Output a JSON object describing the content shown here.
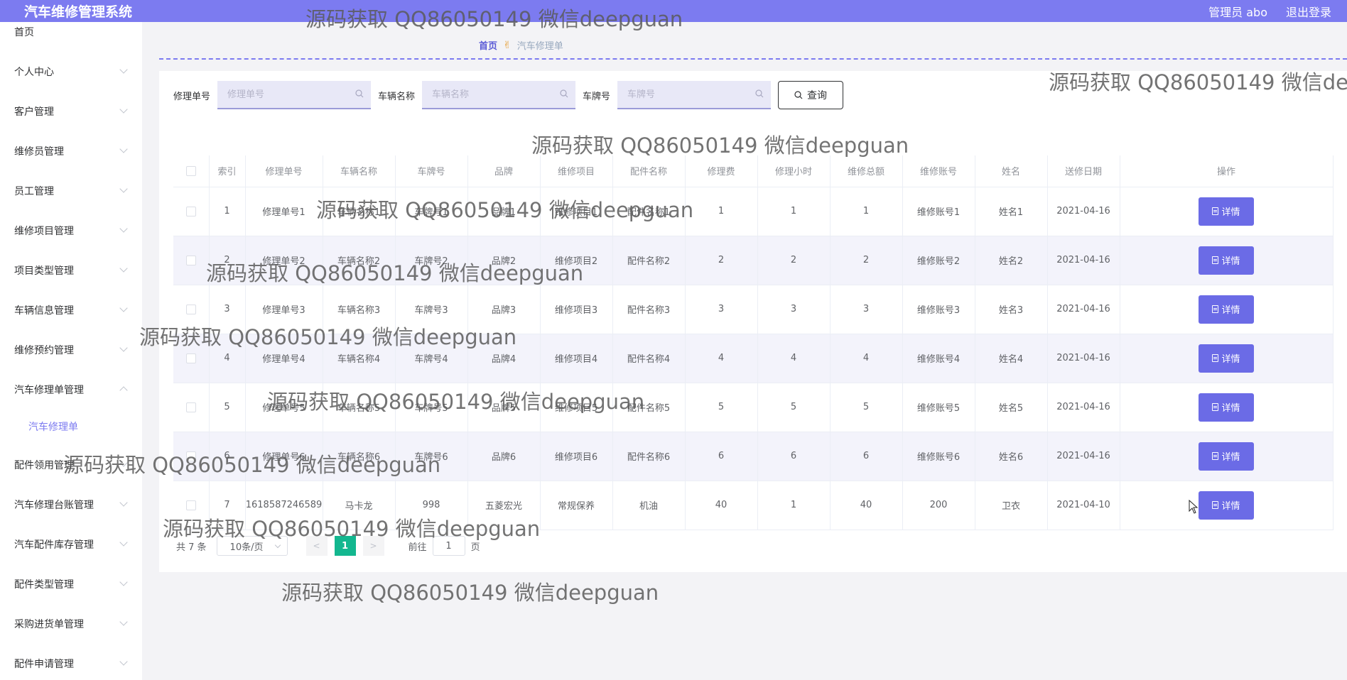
{
  "app": {
    "title": "汽车维修管理系统"
  },
  "user": {
    "greeting": "管理员 abo",
    "logout": "退出登录"
  },
  "sidebar": {
    "items": [
      {
        "label": "首页",
        "expandable": false
      },
      {
        "label": "个人中心",
        "expandable": true
      },
      {
        "label": "客户管理",
        "expandable": true
      },
      {
        "label": "维修员管理",
        "expandable": true
      },
      {
        "label": "员工管理",
        "expandable": true
      },
      {
        "label": "维修项目管理",
        "expandable": true
      },
      {
        "label": "项目类型管理",
        "expandable": true
      },
      {
        "label": "车辆信息管理",
        "expandable": true
      },
      {
        "label": "维修预约管理",
        "expandable": true
      },
      {
        "label": "汽车修理单管理",
        "expandable": true,
        "open": true
      },
      {
        "label": "汽车修理单",
        "sub": true
      },
      {
        "label": "配件领用管理",
        "expandable": true
      },
      {
        "label": "汽车修理台账管理",
        "expandable": true
      },
      {
        "label": "汽车配件库存管理",
        "expandable": true
      },
      {
        "label": "配件类型管理",
        "expandable": true
      },
      {
        "label": "采购进货单管理",
        "expandable": true
      },
      {
        "label": "配件申请管理",
        "expandable": true
      }
    ]
  },
  "breadcrumb": {
    "home": "首页",
    "current": "汽车修理单"
  },
  "search": {
    "fields": [
      {
        "label": "修理单号",
        "placeholder": "修理单号"
      },
      {
        "label": "车辆名称",
        "placeholder": "车辆名称"
      },
      {
        "label": "车牌号",
        "placeholder": "车牌号"
      }
    ],
    "query_label": "查询"
  },
  "table": {
    "columns": [
      "索引",
      "修理单号",
      "车辆名称",
      "车牌号",
      "品牌",
      "维修项目",
      "配件名称",
      "修理费",
      "修理小时",
      "维修总额",
      "维修账号",
      "姓名",
      "送修日期",
      "操作"
    ],
    "action_label": "详情",
    "rows": [
      [
        "1",
        "修理单号1",
        "车辆名称1",
        "车牌号1",
        "品牌1",
        "维修项目1",
        "配件名称1",
        "1",
        "1",
        "1",
        "维修账号1",
        "姓名1",
        "2021-04-16"
      ],
      [
        "2",
        "修理单号2",
        "车辆名称2",
        "车牌号2",
        "品牌2",
        "维修项目2",
        "配件名称2",
        "2",
        "2",
        "2",
        "维修账号2",
        "姓名2",
        "2021-04-16"
      ],
      [
        "3",
        "修理单号3",
        "车辆名称3",
        "车牌号3",
        "品牌3",
        "维修项目3",
        "配件名称3",
        "3",
        "3",
        "3",
        "维修账号3",
        "姓名3",
        "2021-04-16"
      ],
      [
        "4",
        "修理单号4",
        "车辆名称4",
        "车牌号4",
        "品牌4",
        "维修项目4",
        "配件名称4",
        "4",
        "4",
        "4",
        "维修账号4",
        "姓名4",
        "2021-04-16"
      ],
      [
        "5",
        "修理单号5",
        "车辆名称5",
        "车牌号5",
        "品牌5",
        "维修项目5",
        "配件名称5",
        "5",
        "5",
        "5",
        "维修账号5",
        "姓名5",
        "2021-04-16"
      ],
      [
        "6",
        "修理单号6",
        "车辆名称6",
        "车牌号6",
        "品牌6",
        "维修项目6",
        "配件名称6",
        "6",
        "6",
        "6",
        "维修账号6",
        "姓名6",
        "2021-04-16"
      ],
      [
        "7",
        "1618587246589",
        "马卡龙",
        "998",
        "五菱宏光",
        "常规保养",
        "机油",
        "40",
        "1",
        "40",
        "200",
        "卫衣",
        "2021-04-10"
      ]
    ]
  },
  "pagination": {
    "total": "共 7 条",
    "page_size": "10条/页",
    "current_page": "1",
    "goto_label": "前往",
    "goto_value": "1",
    "page_suffix": "页"
  },
  "watermark": {
    "text": "源码获取 QQ86050149 微信deepguan",
    "text_partial": "源码获取 QQ86050149 微信de"
  }
}
